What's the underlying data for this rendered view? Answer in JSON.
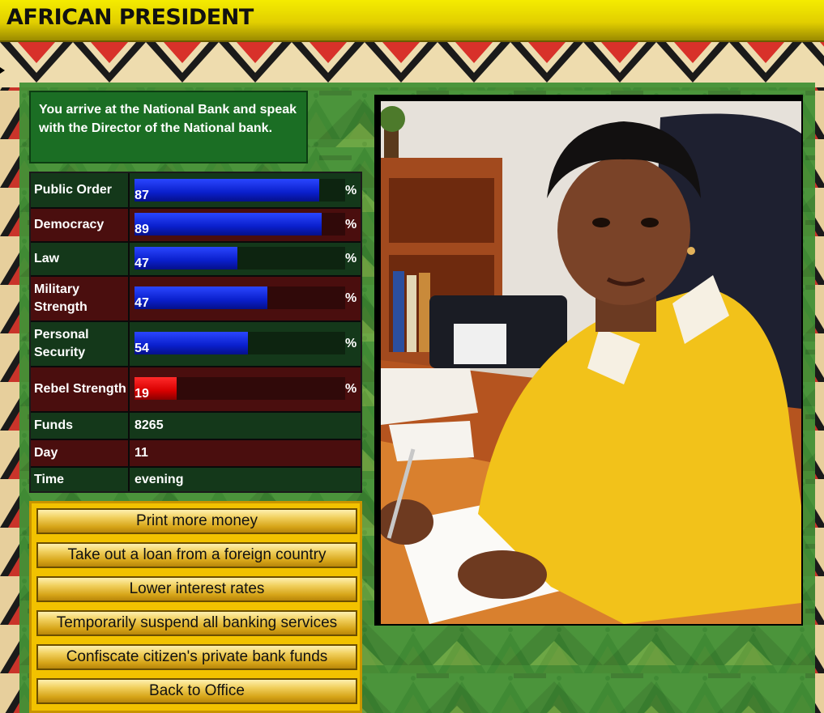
{
  "header": {
    "title": "AFRICAN PRESIDENT"
  },
  "scene": {
    "description": "You arrive at the National Bank and speak with the Director of the National bank.",
    "portrait_icon": "bank-director-portrait"
  },
  "stats": [
    {
      "label": "Public Order",
      "value": "87",
      "percent": 87,
      "unit": "%",
      "bar_color": "#0a1fcc"
    },
    {
      "label": "Democracy",
      "value": "89",
      "percent": 89,
      "unit": "%",
      "bar_color": "#0a1fcc"
    },
    {
      "label": "Law",
      "value": "47",
      "percent": 49,
      "unit": "%",
      "bar_color": "#0a1fcc"
    },
    {
      "label": "Military Strength",
      "value": "47",
      "percent": 63,
      "unit": "%",
      "bar_color": "#0a1fcc"
    },
    {
      "label": "Personal Security",
      "value": "54",
      "percent": 54,
      "unit": "%",
      "bar_color": "#0a1fcc"
    },
    {
      "label": "Rebel Strength",
      "value": "19",
      "percent": 20,
      "unit": "%",
      "bar_color": "#d80000"
    }
  ],
  "info": [
    {
      "label": "Funds",
      "value": "8265"
    },
    {
      "label": "Day",
      "value": "11"
    },
    {
      "label": "Time",
      "value": "evening"
    }
  ],
  "actions": [
    {
      "label": "Print more money"
    },
    {
      "label": "Take out a loan from a foreign country"
    },
    {
      "label": "Lower interest rates"
    },
    {
      "label": "Temporarily suspend all banking services"
    },
    {
      "label": "Confiscate citizen's private bank funds"
    },
    {
      "label": "Back to Office"
    }
  ],
  "colors": {
    "title_bar": "#e2cf00",
    "panel_green": "#46963a",
    "button_gold": "#d6a418"
  }
}
